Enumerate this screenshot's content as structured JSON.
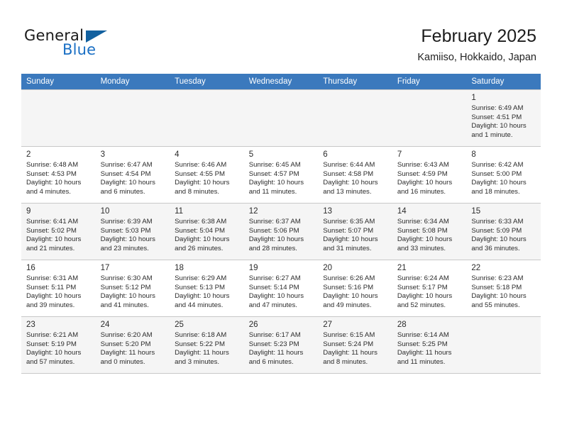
{
  "brand": {
    "name_part1": "General",
    "name_part2": "Blue",
    "flag_icon": "triangle-flag-icon"
  },
  "header": {
    "title": "February 2025",
    "subtitle": "Kamiiso, Hokkaido, Japan"
  },
  "theme": {
    "header_bar_color": "#3b79bd",
    "brand_blue": "#1a6fc4",
    "row_shade_color": "#f5f5f5",
    "grid_line_color": "#c8c8c8"
  },
  "weekday_headers": [
    "Sunday",
    "Monday",
    "Tuesday",
    "Wednesday",
    "Thursday",
    "Friday",
    "Saturday"
  ],
  "weeks": [
    {
      "shaded": true,
      "days": [
        {
          "empty": true
        },
        {
          "empty": true
        },
        {
          "empty": true
        },
        {
          "empty": true
        },
        {
          "empty": true
        },
        {
          "empty": true
        },
        {
          "day": "1",
          "detail": "Sunrise: 6:49 AM\nSunset: 4:51 PM\nDaylight: 10 hours and 1 minute."
        }
      ]
    },
    {
      "shaded": false,
      "days": [
        {
          "day": "2",
          "detail": "Sunrise: 6:48 AM\nSunset: 4:53 PM\nDaylight: 10 hours and 4 minutes."
        },
        {
          "day": "3",
          "detail": "Sunrise: 6:47 AM\nSunset: 4:54 PM\nDaylight: 10 hours and 6 minutes."
        },
        {
          "day": "4",
          "detail": "Sunrise: 6:46 AM\nSunset: 4:55 PM\nDaylight: 10 hours and 8 minutes."
        },
        {
          "day": "5",
          "detail": "Sunrise: 6:45 AM\nSunset: 4:57 PM\nDaylight: 10 hours and 11 minutes."
        },
        {
          "day": "6",
          "detail": "Sunrise: 6:44 AM\nSunset: 4:58 PM\nDaylight: 10 hours and 13 minutes."
        },
        {
          "day": "7",
          "detail": "Sunrise: 6:43 AM\nSunset: 4:59 PM\nDaylight: 10 hours and 16 minutes."
        },
        {
          "day": "8",
          "detail": "Sunrise: 6:42 AM\nSunset: 5:00 PM\nDaylight: 10 hours and 18 minutes."
        }
      ]
    },
    {
      "shaded": true,
      "days": [
        {
          "day": "9",
          "detail": "Sunrise: 6:41 AM\nSunset: 5:02 PM\nDaylight: 10 hours and 21 minutes."
        },
        {
          "day": "10",
          "detail": "Sunrise: 6:39 AM\nSunset: 5:03 PM\nDaylight: 10 hours and 23 minutes."
        },
        {
          "day": "11",
          "detail": "Sunrise: 6:38 AM\nSunset: 5:04 PM\nDaylight: 10 hours and 26 minutes."
        },
        {
          "day": "12",
          "detail": "Sunrise: 6:37 AM\nSunset: 5:06 PM\nDaylight: 10 hours and 28 minutes."
        },
        {
          "day": "13",
          "detail": "Sunrise: 6:35 AM\nSunset: 5:07 PM\nDaylight: 10 hours and 31 minutes."
        },
        {
          "day": "14",
          "detail": "Sunrise: 6:34 AM\nSunset: 5:08 PM\nDaylight: 10 hours and 33 minutes."
        },
        {
          "day": "15",
          "detail": "Sunrise: 6:33 AM\nSunset: 5:09 PM\nDaylight: 10 hours and 36 minutes."
        }
      ]
    },
    {
      "shaded": false,
      "days": [
        {
          "day": "16",
          "detail": "Sunrise: 6:31 AM\nSunset: 5:11 PM\nDaylight: 10 hours and 39 minutes."
        },
        {
          "day": "17",
          "detail": "Sunrise: 6:30 AM\nSunset: 5:12 PM\nDaylight: 10 hours and 41 minutes."
        },
        {
          "day": "18",
          "detail": "Sunrise: 6:29 AM\nSunset: 5:13 PM\nDaylight: 10 hours and 44 minutes."
        },
        {
          "day": "19",
          "detail": "Sunrise: 6:27 AM\nSunset: 5:14 PM\nDaylight: 10 hours and 47 minutes."
        },
        {
          "day": "20",
          "detail": "Sunrise: 6:26 AM\nSunset: 5:16 PM\nDaylight: 10 hours and 49 minutes."
        },
        {
          "day": "21",
          "detail": "Sunrise: 6:24 AM\nSunset: 5:17 PM\nDaylight: 10 hours and 52 minutes."
        },
        {
          "day": "22",
          "detail": "Sunrise: 6:23 AM\nSunset: 5:18 PM\nDaylight: 10 hours and 55 minutes."
        }
      ]
    },
    {
      "shaded": true,
      "days": [
        {
          "day": "23",
          "detail": "Sunrise: 6:21 AM\nSunset: 5:19 PM\nDaylight: 10 hours and 57 minutes."
        },
        {
          "day": "24",
          "detail": "Sunrise: 6:20 AM\nSunset: 5:20 PM\nDaylight: 11 hours and 0 minutes."
        },
        {
          "day": "25",
          "detail": "Sunrise: 6:18 AM\nSunset: 5:22 PM\nDaylight: 11 hours and 3 minutes."
        },
        {
          "day": "26",
          "detail": "Sunrise: 6:17 AM\nSunset: 5:23 PM\nDaylight: 11 hours and 6 minutes."
        },
        {
          "day": "27",
          "detail": "Sunrise: 6:15 AM\nSunset: 5:24 PM\nDaylight: 11 hours and 8 minutes."
        },
        {
          "day": "28",
          "detail": "Sunrise: 6:14 AM\nSunset: 5:25 PM\nDaylight: 11 hours and 11 minutes."
        },
        {
          "empty": true
        }
      ]
    }
  ]
}
